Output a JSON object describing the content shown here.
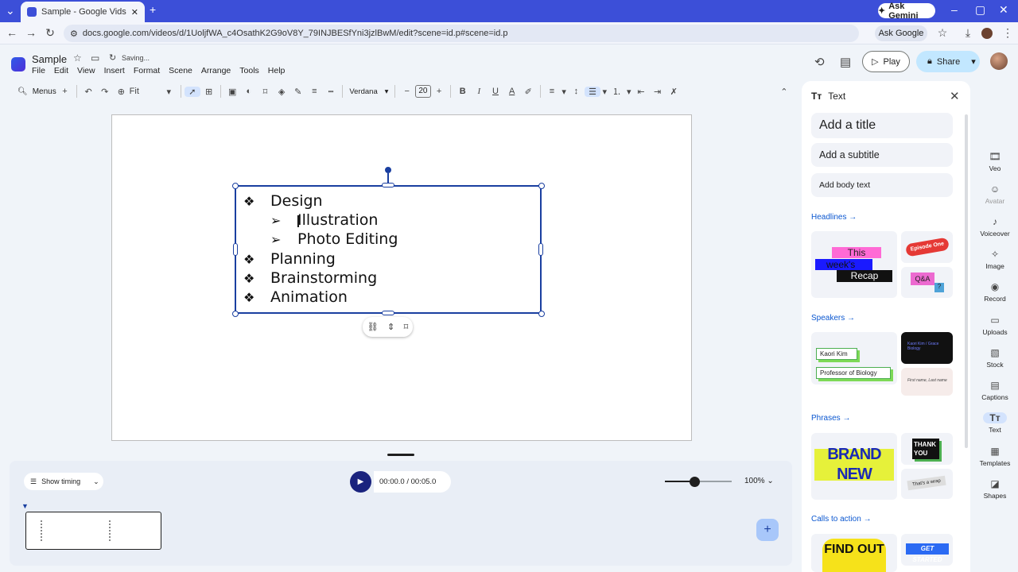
{
  "browser": {
    "tab_title": "Sample - Google Vids",
    "url": "docs.google.com/videos/d/1UoljfWA_c4OsathK2G9oV8Y_79INJBESfYni3jzlBwM/edit?scene=id.p#scene=id.p",
    "ask_gemini": "Ask Gemini",
    "ask_google": "Ask Google"
  },
  "app": {
    "doc_title": "Sample",
    "status": "Saving...",
    "menu": [
      "File",
      "Edit",
      "View",
      "Insert",
      "Format",
      "Scene",
      "Arrange",
      "Tools",
      "Help"
    ],
    "play_label": "Play",
    "share_label": "Share"
  },
  "toolbar": {
    "menus_label": "Menus",
    "zoom_fit": "Fit",
    "font": "Verdana",
    "font_size": "20"
  },
  "slide": {
    "bullets": [
      {
        "glyph": "❖",
        "text": "Design",
        "level": 0
      },
      {
        "glyph": "➢",
        "text": "Illustration",
        "level": 1
      },
      {
        "glyph": "➢",
        "text": "Photo Editing",
        "level": 1
      },
      {
        "glyph": "❖",
        "text": "Planning",
        "level": 0
      },
      {
        "glyph": "❖",
        "text": "Brainstorming",
        "level": 0
      },
      {
        "glyph": "❖",
        "text": "Animation",
        "level": 0
      }
    ]
  },
  "timeline": {
    "show_timing": "Show timing",
    "timecode": "00:00.0 / 00:05.0",
    "zoom": "100%",
    "zoom_fraction": 0.45
  },
  "panel": {
    "title": "Text",
    "add_title": "Add a title",
    "add_subtitle": "Add a subtitle",
    "add_body": "Add body text",
    "sections": {
      "headlines": "Headlines",
      "speakers": "Speakers",
      "phrases": "Phrases",
      "calls_to_action": "Calls to action"
    },
    "cards": {
      "this": "This",
      "weeks": "week's",
      "recap": "Recap",
      "episode_one": "Episode One",
      "qa": "Q&A",
      "speaker_name": "Kaori Kim",
      "speaker_role": "Professor of Biology",
      "dark_speaker": "Kaori Kim / Grace Biology",
      "first_last": "First name, Last name",
      "brand_new_1": "BRAND",
      "brand_new_2": "NEW",
      "thank_you": "THANK YOU",
      "thats_a_wrap": "That's a wrap",
      "find_out": "FIND OUT",
      "get_started": "GET STARTED"
    }
  },
  "rail": [
    {
      "label": "Veo",
      "icon": "film-plus-icon"
    },
    {
      "label": "Avatar",
      "icon": "avatar-icon"
    },
    {
      "label": "Voiceover",
      "icon": "voiceover-icon"
    },
    {
      "label": "Image",
      "icon": "image-icon"
    },
    {
      "label": "Record",
      "icon": "record-icon"
    },
    {
      "label": "Uploads",
      "icon": "folder-icon"
    },
    {
      "label": "Stock",
      "icon": "stock-icon"
    },
    {
      "label": "Captions",
      "icon": "captions-icon"
    },
    {
      "label": "Text",
      "icon": "text-icon"
    },
    {
      "label": "Templates",
      "icon": "templates-icon"
    },
    {
      "label": "Shapes",
      "icon": "shapes-icon"
    }
  ],
  "colors": {
    "accent": "#1a3fa0",
    "share": "#c2e7ff",
    "chrome": "#3c4fd8"
  }
}
